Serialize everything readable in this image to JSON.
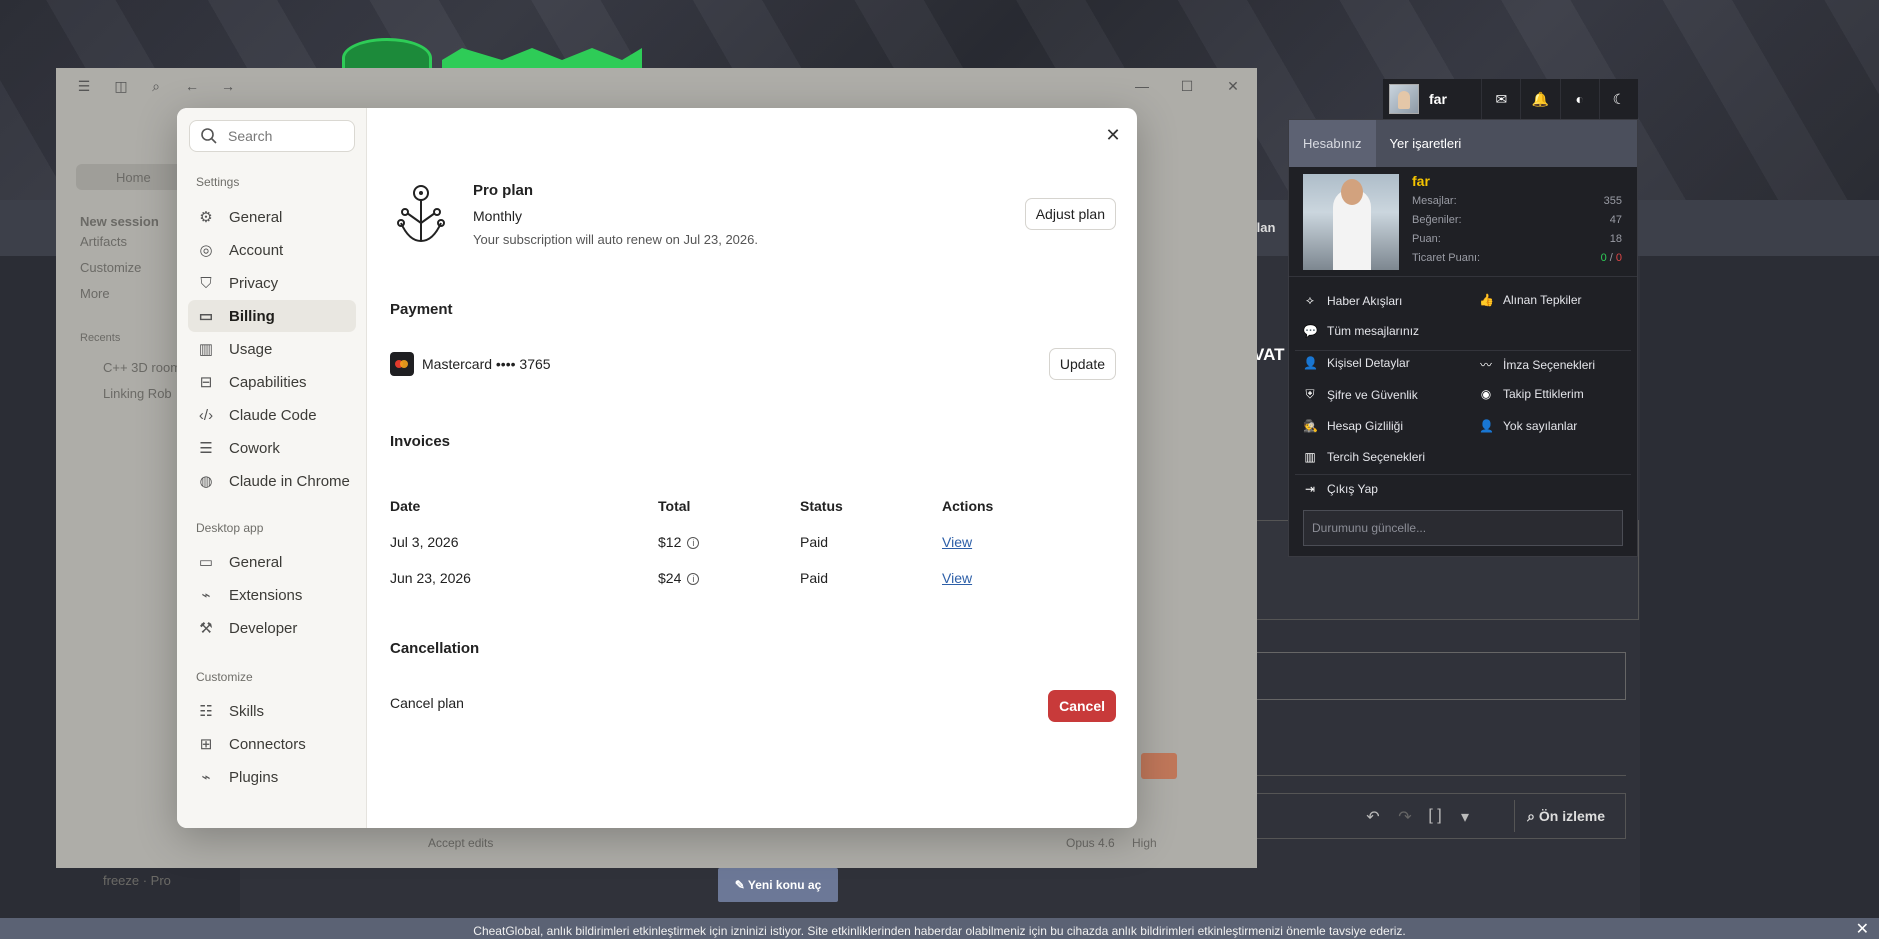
{
  "background": {
    "partial_heading": "VAT",
    "partial_label": "llan",
    "new_topic_label": "Yeni konu aç",
    "preview_label": "Ön izleme",
    "notice": "CheatGlobal, anlık bildirimleri etkinleştirmek için izninizi istiyor. Site etkinliklerinden haberdar olabilmeniz için bu cihazda anlık bildirimleri etkinleştirmenizi önemle tavsiye ederiz."
  },
  "user_nav": {
    "username": "far"
  },
  "dropdown": {
    "tabs": [
      "Hesabınız",
      "Yer işaretleri"
    ],
    "name": "far",
    "stats": [
      {
        "label": "Mesajlar:",
        "value": "355"
      },
      {
        "label": "Beğeniler:",
        "value": "47"
      },
      {
        "label": "Puan:",
        "value": "18"
      },
      {
        "label": "Ticaret Puanı:",
        "value_pos": "0",
        "sep": " / ",
        "value_neg": "0"
      }
    ],
    "menu": {
      "news_feed": "Haber Akışları",
      "reactions": "Alınan Tepkiler",
      "all_messages": "Tüm mesajlarınız",
      "personal": "Kişisel Detaylar",
      "signature": "İmza Seçenekleri",
      "password": "Şifre ve Güvenlik",
      "following": "Takip Ettiklerim",
      "privacy": "Hesap Gizliliği",
      "ignored": "Yok sayılanlar",
      "preferences": "Tercih Seçenekleri",
      "logout": "Çıkış Yap"
    },
    "status_placeholder": "Durumunu güncelle..."
  },
  "app_window": {
    "home": "Home",
    "side_items": [
      "New session",
      "Artifacts",
      "Customize",
      "More"
    ],
    "recents_label": "Recents",
    "recents": [
      "C++ 3D room",
      "Linking Rob"
    ],
    "user": "freeze · Pro",
    "footer": [
      "Accept edits",
      "Opus 4.6",
      "High"
    ]
  },
  "settings": {
    "search_placeholder": "Search",
    "sections": {
      "settings": "Settings",
      "desktop": "Desktop app",
      "customize": "Customize"
    },
    "nav_settings": [
      "General",
      "Account",
      "Privacy",
      "Billing",
      "Usage",
      "Capabilities",
      "Claude Code",
      "Cowork",
      "Claude in Chrome"
    ],
    "nav_desktop": [
      "General",
      "Extensions",
      "Developer"
    ],
    "nav_customize": [
      "Skills",
      "Connectors",
      "Plugins"
    ]
  },
  "billing": {
    "plan_title": "Pro plan",
    "plan_cycle": "Monthly",
    "plan_renew": "Your subscription will auto renew on Jul 23, 2026.",
    "adjust_label": "Adjust plan",
    "payment_title": "Payment",
    "card": "Mastercard •••• 3765",
    "update_label": "Update",
    "invoices_title": "Invoices",
    "columns": [
      "Date",
      "Total",
      "Status",
      "Actions"
    ],
    "invoices": [
      {
        "date": "Jul 3, 2026",
        "total": "$12",
        "status": "Paid",
        "action": "View"
      },
      {
        "date": "Jun 23, 2026",
        "total": "$24",
        "status": "Paid",
        "action": "View"
      }
    ],
    "cancellation_title": "Cancellation",
    "cancel_plan_label": "Cancel plan",
    "cancel_button": "Cancel"
  },
  "colors": {
    "accent_red": "#c83a3a",
    "link": "#2d5fa8",
    "username_gold": "#f5c400"
  }
}
